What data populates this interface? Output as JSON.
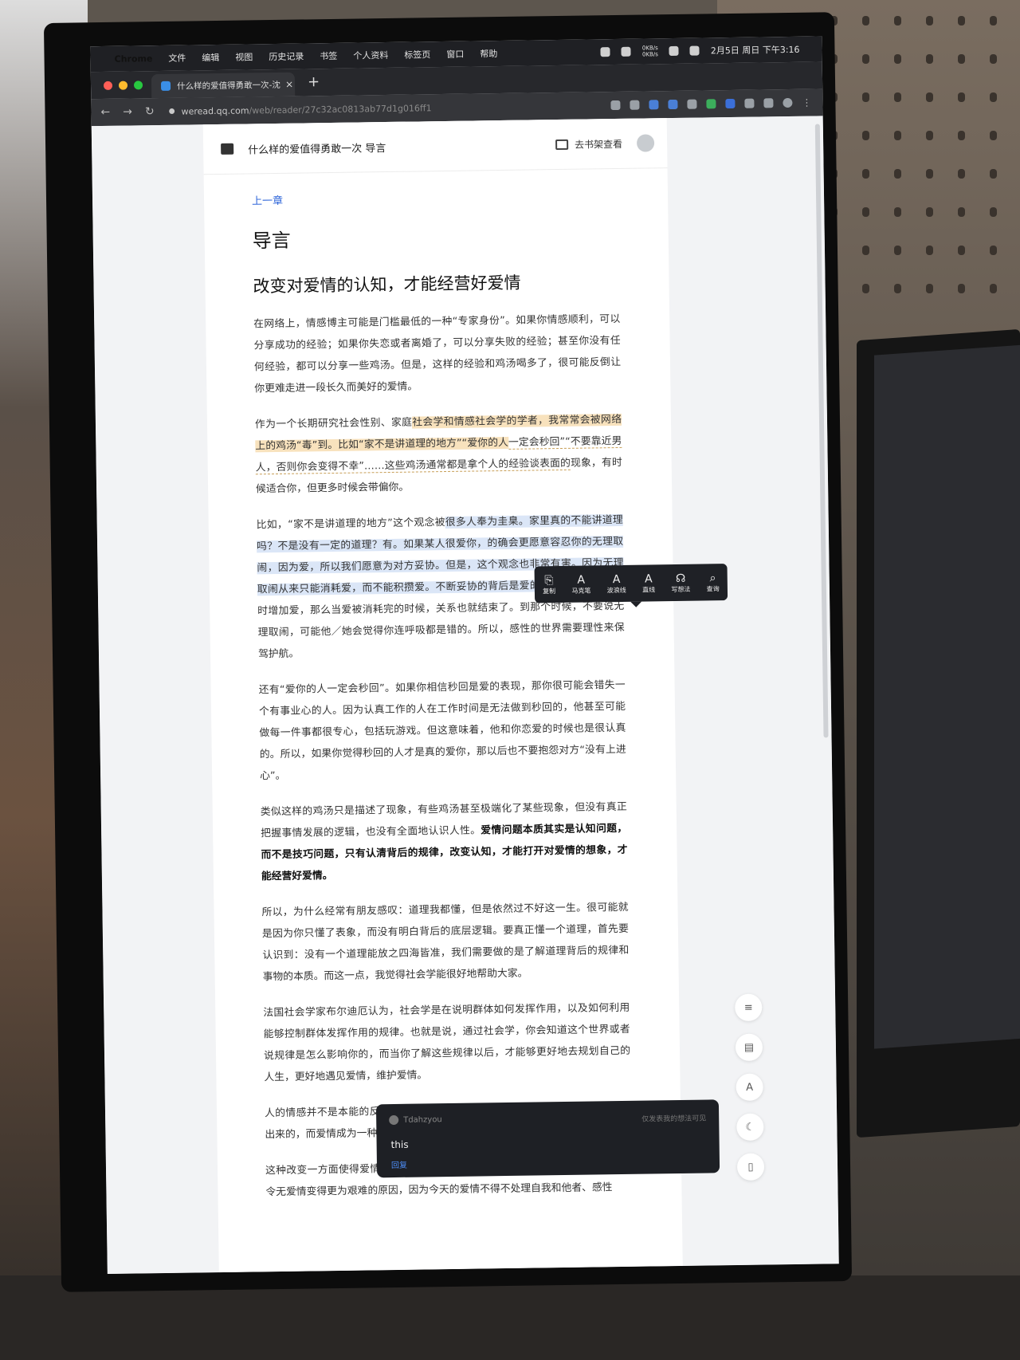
{
  "menubar": {
    "app": "Chrome",
    "items": [
      "文件",
      "编辑",
      "视图",
      "历史记录",
      "书签",
      "个人资料",
      "标签页",
      "窗口",
      "帮助"
    ],
    "net_up": "0KB/s",
    "net_down": "0KB/s",
    "clock": "2月5日 周日 下午3:16"
  },
  "tab": {
    "title": "什么样的爱值得勇敢一次-沈奕斐",
    "close": "×",
    "new_tab": "+"
  },
  "address": {
    "host": "weread.qq.com",
    "path": "/web/reader/27c32ac0813ab77d1g016ff1"
  },
  "reader": {
    "book_title": "什么样的爱值得勇敢一次 导言",
    "shelf_label": "去书架查看",
    "prev_chapter": "上一章",
    "chapter_title": "导言",
    "section_title": "改变对爱情的认知，才能经营好爱情",
    "p1": "在网络上，情感博主可能是门槛最低的一种“专家身份”。如果你情感顺利，可以分享成功的经验；如果你失恋或者离婚了，可以分享失败的经验；甚至你没有任何经验，都可以分享一些鸡汤。但是，这样的经验和鸡汤喝多了，很可能反倒让你更难走进一段长久而美好的爱情。",
    "p2a": "作为一个长期研究社会性别、家庭",
    "p2b": "社会学和情感社会学的学者，我常常会被网络上的鸡汤“毒”到。比如“家不是讲道理的地方”“爱你的人",
    "p2c": "一定会秒回”“不要靠近男人，否则你会变得不幸”……这些鸡汤通常都是拿个人的经验谈表面的",
    "p2d": "现象，有时候适合你，但更多时候会带偏你。",
    "p3a": "比如，“家不是讲道理的地方”这个观念被",
    "p3b": "很多人奉为圭臬。家里真的不能讲道理吗？不是没有一定的道理？有。如果某人很爱你，的确会更愿意容忍你的无理取闹，因为爱，所以我们愿意为对方妥协。但是，这个观念也非常有害。因为无理取闹从来只能消耗爱，而不能积攒爱。不断妥协的背后是爱的疲惫。",
    "p3c": "如果不能同时增加爱，那么当爱被消耗完的时候，关系也就结束了。到那个时候，不要说无理取闹，可能他／她会觉得你连呼吸都是错的。所以，感性的世界需要理性来保驾护航。",
    "p4": "还有“爱你的人一定会秒回”。如果你相信秒回是爱的表现，那你很可能会错失一个有事业心的人。因为认真工作的人在工作时间是无法做到秒回的，他甚至可能做每一件事都很专心，包括玩游戏。但这意味着，他和你恋爱的时候也是很认真的。所以，如果你觉得秒回的人才是真的爱你，那以后也不要抱怨对方“没有上进心”。",
    "p5a": "类似这样的鸡汤只是描述了现象，有些鸡汤甚至极端化了某些现象，但没有真正把握事情发展的逻辑，也没有全面地认识人性。",
    "p5b": "爱情问题本质其实是认知问题，而不是技巧问题，只有认清背后的规律，改变认知，才能打开对爱情的想象，才能经营好爱情。",
    "p6": "所以，为什么经常有朋友感叹：道理我都懂，但是依然过不好这一生。很可能就是因为你只懂了表象，而没有明白背后的底层逻辑。要真正懂一个道理，首先要认识到：没有一个道理能放之四海皆准，我们需要做的是了解道理背后的规律和事物的本质。而这一点，我觉得社会学能很好地帮助大家。",
    "p7": "法国社会学家布尔迪厄认为，社会学是在说明群体如何发挥作用，以及如何利用能够控制群体发挥作用的规律。也就是说，通过社会学，你会知道这个世界或者说规律是怎么影响你的，而当你了解这些规律以后，才能够更好地去规划自己的人生，更好地遇见爱情，维护爱情。",
    "p8": "人的情感并不是本能的反应，我们的情感反应其实是在社会文化的影响下被形塑出来的，而爱情成为一种日常生活中的重要情感其实才仅有100年左右的历史。",
    "p9": "这种改变一方面使得爱情变得更接近齐美尔所说的“纯粹关系”，但另一方面也是令无爱情变得更为艰难的原因，因为今天的爱情不得不处理自我和他者、感性"
  },
  "toolbar": [
    {
      "glyph": "⎘",
      "label": "复制"
    },
    {
      "glyph": "A",
      "label": "马克笔"
    },
    {
      "glyph": "A",
      "label": "波浪线"
    },
    {
      "glyph": "A",
      "label": "直线"
    },
    {
      "glyph": "☊",
      "label": "写想法"
    },
    {
      "glyph": "⌕",
      "label": "查询"
    }
  ],
  "side_buttons": [
    "≡",
    "▤",
    "A",
    "☾",
    "▯"
  ],
  "popup": {
    "user": "Tdahzyou",
    "hint": "仅发表我的想法可见",
    "message": "this",
    "action": "回复"
  }
}
